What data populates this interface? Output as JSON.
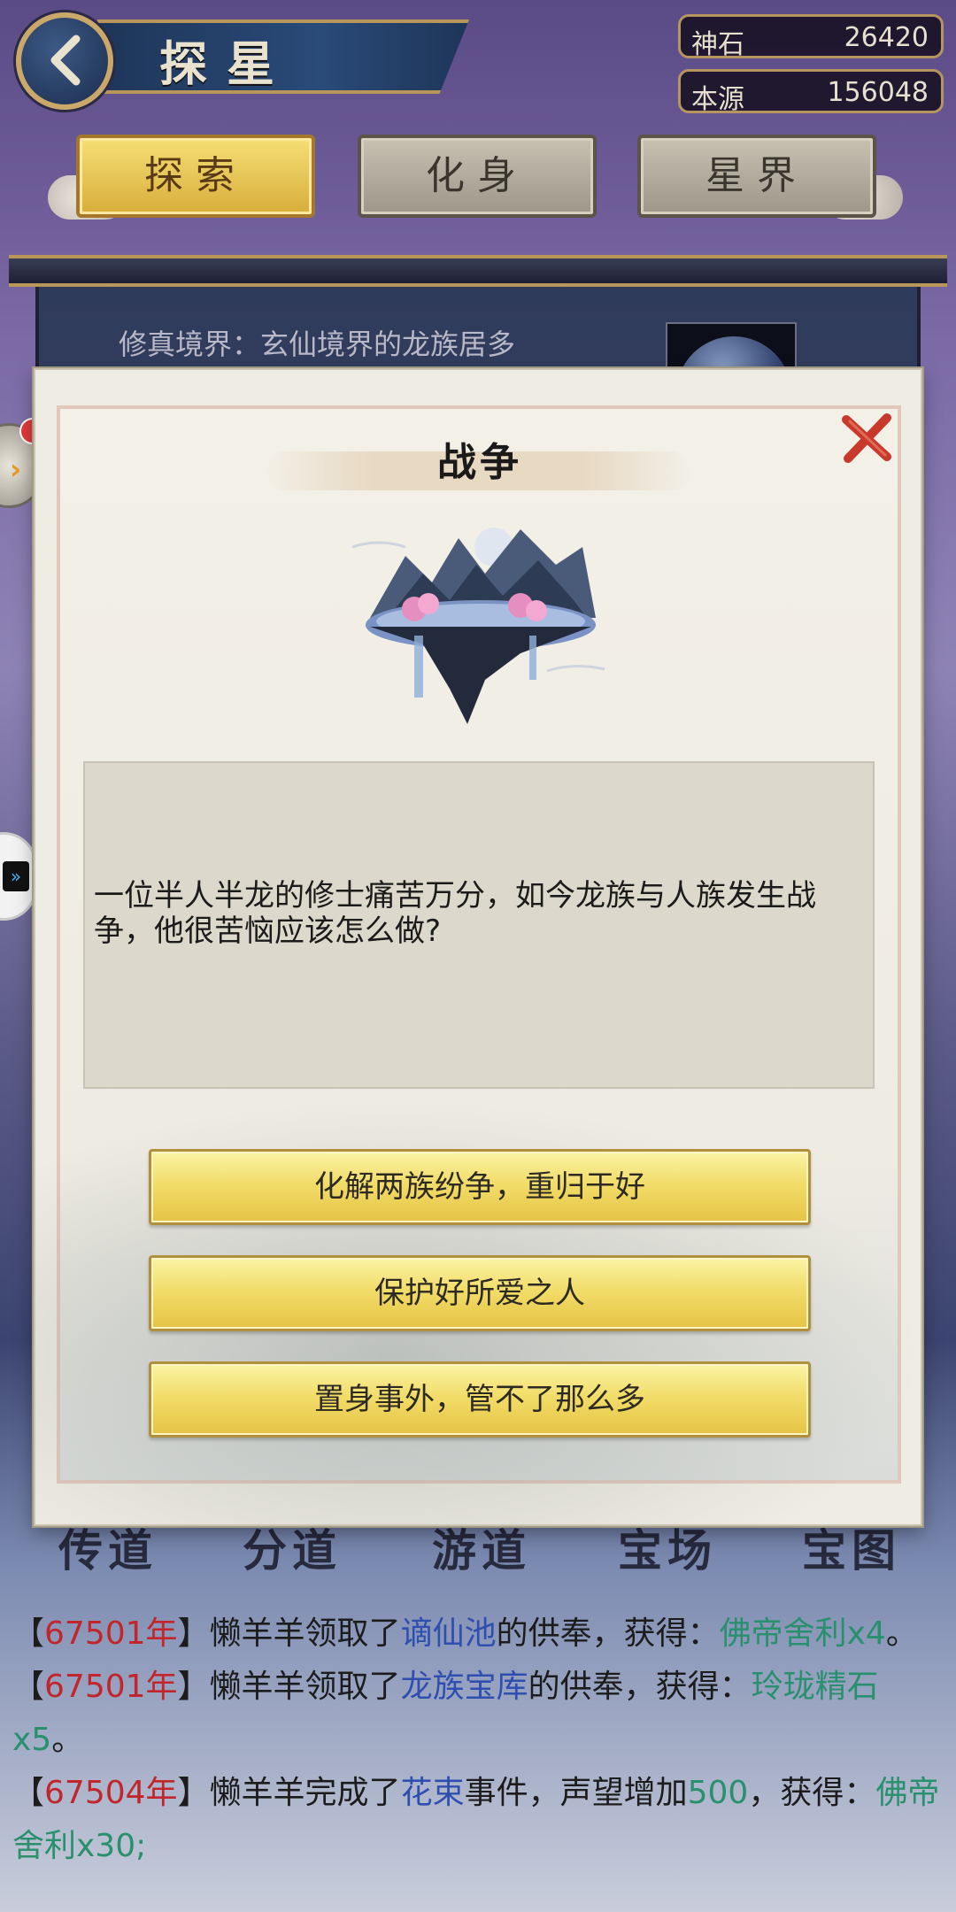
{
  "header": {
    "title": "探星",
    "back_icon": "back-arrow-icon",
    "resources": [
      {
        "label": "神石",
        "value": "26420"
      },
      {
        "label": "本源",
        "value": "156048"
      }
    ]
  },
  "tabs": [
    {
      "label": "探索",
      "active": true
    },
    {
      "label": "化身",
      "active": false
    },
    {
      "label": "星界",
      "active": false
    }
  ],
  "background_panel": {
    "realm_text": "修真境界：玄仙境界的龙族居多"
  },
  "bottom_nav": [
    "传道",
    "分道",
    "游道",
    "宝场",
    "宝图"
  ],
  "modal": {
    "title": "战争",
    "close_icon": "close-x-icon",
    "image": "floating-island-icon",
    "description": "一位半人半龙的修士痛苦万分，如今龙族与人族发生战争，他很苦恼应该怎么做?",
    "choices": [
      "化解两族纷争，重归于好",
      "保护好所爱之人",
      "置身事外，管不了那么多"
    ]
  },
  "event_log": [
    {
      "pre": "【",
      "year": "67501年",
      "mid1": "】懒羊羊领取了",
      "place": "谪仙池",
      "mid2": "的供奉，获得：",
      "item": "佛帝舍利x4",
      "post": "。"
    },
    {
      "pre": "【",
      "year": "67501年",
      "mid1": "】懒羊羊领取了",
      "place": "龙族宝库",
      "mid2": "的供奉，获得：",
      "item": "玲珑精石x5",
      "post": "。"
    },
    {
      "pre": "【",
      "year": "67504年",
      "mid1": "】懒羊羊完成了",
      "place": "花束",
      "mid2": "事件，声望增加",
      "item": "500",
      "post": "，获得：",
      "item2": "佛帝舍利x30;"
    }
  ],
  "colors": {
    "accent_gold": "#e5c343",
    "log_year": "#c0262c",
    "log_place": "#2f4fb0",
    "log_item": "#29906e"
  }
}
